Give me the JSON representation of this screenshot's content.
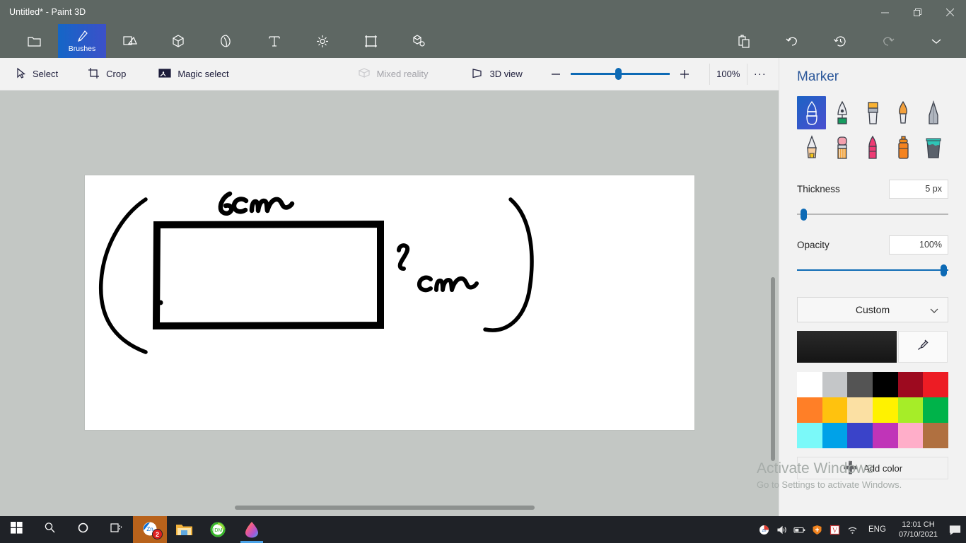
{
  "window": {
    "title": "Untitled* - Paint 3D",
    "controls": [
      {
        "name": "minimize",
        "glyph": "minimize-icon"
      },
      {
        "name": "restore",
        "glyph": "restore-icon"
      },
      {
        "name": "close",
        "glyph": "close-icon"
      }
    ]
  },
  "toolbar_main": {
    "items": [
      {
        "label": "",
        "icon": "menu-folder-icon",
        "state": "normal"
      },
      {
        "label": "Brushes",
        "icon": "brush-icon",
        "state": "active"
      },
      {
        "label": "",
        "icon": "shapes-2d-icon",
        "state": "normal"
      },
      {
        "label": "",
        "icon": "shapes-3d-icon",
        "state": "normal"
      },
      {
        "label": "",
        "icon": "stickers-icon",
        "state": "normal"
      },
      {
        "label": "",
        "icon": "text-icon",
        "state": "normal"
      },
      {
        "label": "",
        "icon": "effects-icon",
        "state": "normal"
      },
      {
        "label": "",
        "icon": "canvas-icon",
        "state": "normal"
      },
      {
        "label": "",
        "icon": "3d-library-icon",
        "state": "normal"
      }
    ],
    "right_items": [
      {
        "label": "",
        "icon": "paste-icon",
        "state": "normal"
      },
      {
        "label": "",
        "icon": "undo-icon",
        "state": "normal"
      },
      {
        "label": "",
        "icon": "history-icon",
        "state": "normal"
      },
      {
        "label": "",
        "icon": "redo-icon",
        "state": "disabled"
      },
      {
        "label": "",
        "icon": "chevron-down-icon",
        "state": "normal"
      }
    ]
  },
  "toolbar_sub": {
    "select_label": "Select",
    "crop_label": "Crop",
    "magic_select_label": "Magic select",
    "mixed_reality_label": "Mixed reality",
    "view_3d_label": "3D view",
    "zoom_percent": "100%",
    "zoom_out_label": "−",
    "zoom_in_label": "+",
    "more_label": "···"
  },
  "canvas": {
    "drawing_annotations": [
      {
        "text": "6cm",
        "kind": "handwritten-label"
      },
      {
        "text": "2 cm",
        "kind": "handwritten-label"
      }
    ],
    "shapes": [
      "rectangle-outline",
      "left-bracket-curve",
      "right-bracket-curve"
    ],
    "stroke_color": "#000000",
    "background": "#ffffff"
  },
  "side_panel": {
    "title": "Marker",
    "brushes": [
      {
        "name": "marker",
        "selected": true
      },
      {
        "name": "calligraphy-pen",
        "selected": false
      },
      {
        "name": "oil-brush",
        "selected": false
      },
      {
        "name": "watercolor-brush",
        "selected": false
      },
      {
        "name": "pixel-pen",
        "selected": false
      },
      {
        "name": "pencil",
        "selected": false
      },
      {
        "name": "eraser",
        "selected": false
      },
      {
        "name": "crayon",
        "selected": false
      },
      {
        "name": "spray-can",
        "selected": false
      },
      {
        "name": "fill-bucket",
        "selected": false
      }
    ],
    "thickness": {
      "label": "Thickness",
      "value": "5 px",
      "percent": 4
    },
    "opacity": {
      "label": "Opacity",
      "value": "100%",
      "percent": 100
    },
    "color_picker": {
      "dropdown_label": "Custom",
      "current_color": "#232323",
      "eyedropper": "eyedropper-icon",
      "add_color_label": "Add color",
      "swatches": [
        "#ffffff",
        "#c4c6c8",
        "#545454",
        "#000000",
        "#9d0a1f",
        "#ed1c24",
        "#ff7f27",
        "#ffc20e",
        "#fbe0a3",
        "#fff200",
        "#a6ed28",
        "#00b34a",
        "#7bf9f9",
        "#00a2e8",
        "#3a43c9",
        "#c034b8",
        "#ffaec9",
        "#b07040"
      ]
    }
  },
  "watermark": {
    "line1": "Activate Windows",
    "line2": "Go to Settings to activate Windows."
  },
  "taskbar": {
    "buttons": [
      {
        "name": "start-button",
        "icon": "windows-logo-icon"
      },
      {
        "name": "search-button",
        "icon": "search-icon"
      },
      {
        "name": "cortana-button",
        "icon": "cortana-circle-icon"
      },
      {
        "name": "task-view-button",
        "icon": "task-view-icon"
      }
    ],
    "apps": [
      {
        "name": "zalo",
        "badge": "2",
        "active": false
      },
      {
        "name": "file-explorer",
        "badge": "",
        "active": false
      },
      {
        "name": "green-app",
        "badge": "",
        "active": false
      },
      {
        "name": "paint-3d",
        "badge": "",
        "active": true
      }
    ],
    "tray": {
      "language": "ENG",
      "time": "12:01 CH",
      "date": "07/10/2021"
    }
  }
}
